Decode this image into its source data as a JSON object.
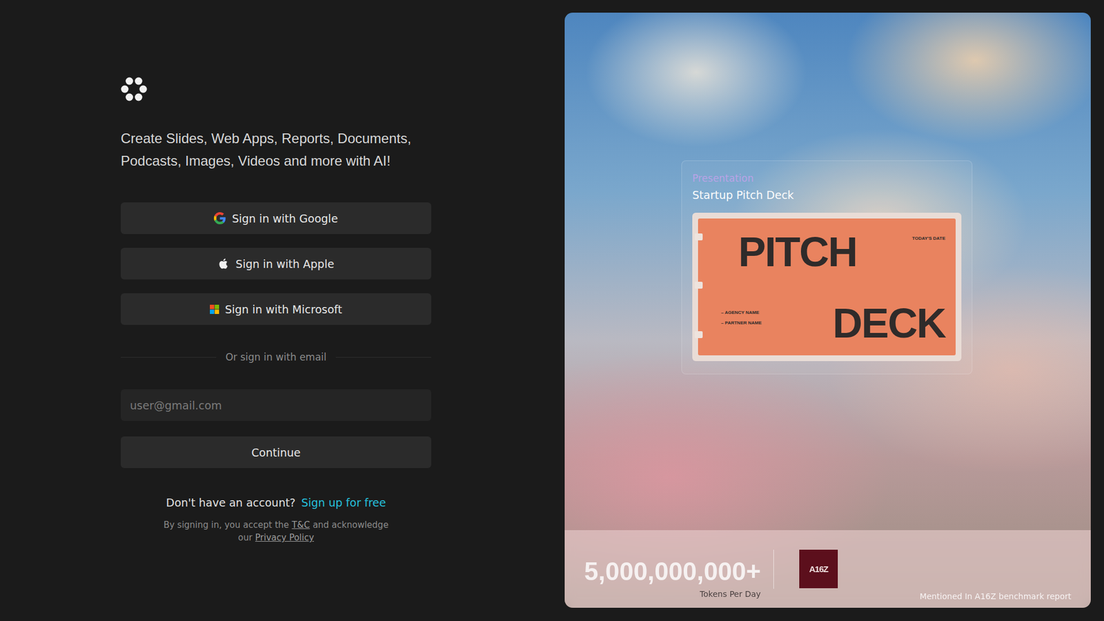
{
  "tagline_lines": [
    "Create Slides, Web Apps, Reports, Documents,",
    "Podcasts, Images, Videos and more with AI!"
  ],
  "sso_buttons": [
    {
      "label": "Sign in with Google",
      "kind": "google"
    },
    {
      "label": "Sign in with Apple",
      "kind": "apple"
    },
    {
      "label": "Sign in with Microsoft",
      "kind": "microsoft"
    }
  ],
  "divider": "Or sign in with email",
  "email": {
    "placeholder": "user@gmail.com"
  },
  "continue_button": "Continue",
  "signup": {
    "prompt": "Don't have an account?",
    "link": "Sign up for free"
  },
  "legal": {
    "line1_text": "By signing in, you accept the",
    "terms": "T&C",
    "line1_end": "and acknowledge",
    "line2_text": "our",
    "privacy": "Privacy Policy"
  },
  "showcase": {
    "category": "Presentation",
    "title": "Startup Pitch Deck",
    "slide": {
      "word1": "PITCH",
      "word2": "DECK",
      "date": "TODAY'S DATE",
      "names": [
        "– AGENCY NAME",
        "– PARTNER NAME"
      ]
    }
  },
  "stats": {
    "value": "5,000,000,000+",
    "label": "Tokens Per Day",
    "badge": "A16Z",
    "note": "Mentioned In A16Z benchmark report"
  }
}
